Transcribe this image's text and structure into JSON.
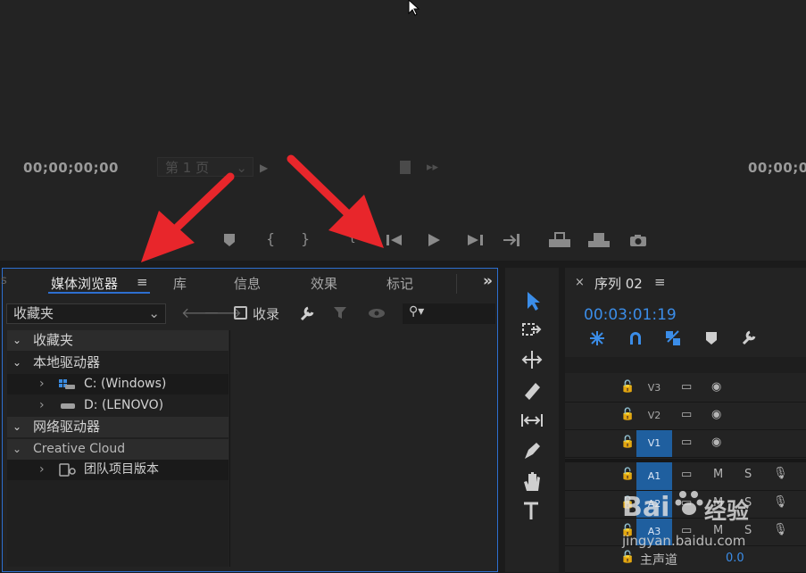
{
  "program_monitor": {
    "timecode_left": "00;00;00;00",
    "timecode_right": "00;00;00",
    "page_select": "第 1 页"
  },
  "media_browser": {
    "tabs": [
      {
        "label": "媒体浏览器",
        "active": true
      },
      {
        "label": "库"
      },
      {
        "label": "信息"
      },
      {
        "label": "效果"
      },
      {
        "label": "标记"
      }
    ],
    "favorites_select": "收藏夹",
    "ingest_label": "收录",
    "tree": [
      {
        "label": "收藏夹"
      },
      {
        "label": "本地驱动器"
      },
      {
        "label": "C: (Windows)"
      },
      {
        "label": "D: (LENOVO)"
      },
      {
        "label": "网络驱动器"
      },
      {
        "label": "Creative Cloud"
      },
      {
        "label": "团队项目版本"
      }
    ]
  },
  "timeline": {
    "sequence_name": "序列 02",
    "timecode": "00:03:01:19",
    "tracks": [
      {
        "label": "V3"
      },
      {
        "label": "V2"
      },
      {
        "label": "V1"
      },
      {
        "label": "A1",
        "m": "M",
        "s": "S"
      },
      {
        "label": "A2",
        "m": "M",
        "s": "S"
      },
      {
        "label": "A3",
        "m": "M",
        "s": "S"
      }
    ],
    "master_label": "主声道",
    "master_value": "0.0"
  },
  "watermark": {
    "brand": "Bai",
    "brand_cn": "经验",
    "url": "jingyan.baidu.com"
  },
  "colors": {
    "accent_blue": "#2d6fd0",
    "arrow_red": "#e8262b",
    "track_blue": "#1f5f9f"
  }
}
